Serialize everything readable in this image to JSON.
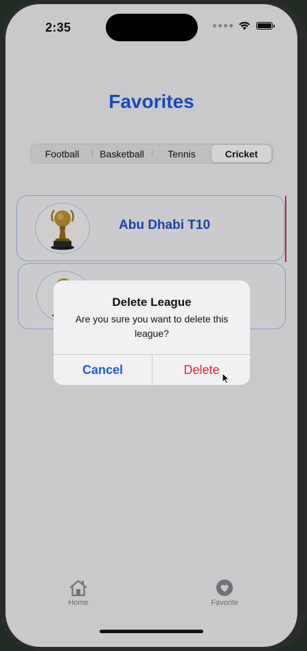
{
  "status_bar": {
    "time": "2:35"
  },
  "header": {
    "title": "Favorites"
  },
  "sports_tabs": [
    {
      "label": "Football",
      "selected": false
    },
    {
      "label": "Basketball",
      "selected": false
    },
    {
      "label": "Tennis",
      "selected": false
    },
    {
      "label": "Cricket",
      "selected": true
    }
  ],
  "leagues": [
    {
      "name": "Abu Dhabi T10",
      "logo": "trophy-icon"
    },
    {
      "name": "",
      "logo": "trophy-icon"
    }
  ],
  "alert": {
    "title": "Delete League",
    "message": "Are you sure you want to delete this league?",
    "cancel_label": "Cancel",
    "delete_label": "Delete"
  },
  "tab_bar": [
    {
      "label": "Home",
      "icon": "house-icon"
    },
    {
      "label": "Favorite",
      "icon": "heart-circle-icon"
    }
  ],
  "colors": {
    "accent": "#1f57e6",
    "destructive": "#d9283a"
  }
}
